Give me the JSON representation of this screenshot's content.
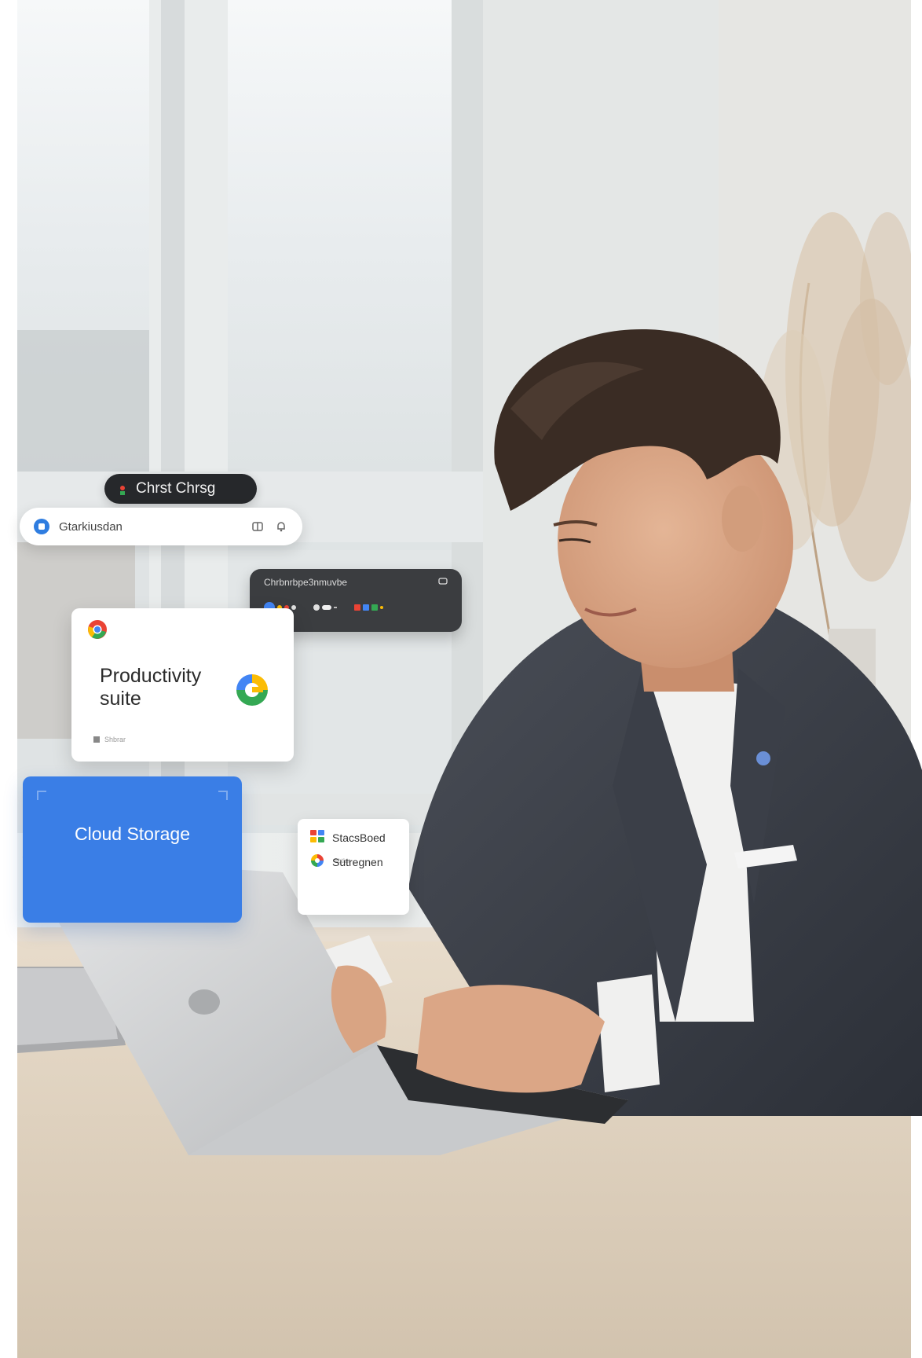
{
  "scene": {
    "description_icons": [
      "laptop",
      "window",
      "pampas-grass"
    ]
  },
  "dark_pill": {
    "label": "Chrst Chrsg",
    "icon": "google-dot-icon"
  },
  "search_bar": {
    "placeholder_text": "Gtarkiusdan",
    "left_icon": "app-badge-icon",
    "right_icons": [
      "grid-icon",
      "bell-icon"
    ]
  },
  "dark_panel": {
    "title": "Chrbnrbpe3nmuvbe",
    "corner_icon": "chat-icon"
  },
  "productivity_card": {
    "title": "Productivity suite",
    "footer": "Shbrar",
    "top_icon": "chrome-icon",
    "brand_icon": "google-g-icon"
  },
  "cloud_card": {
    "label": "Cloud Storage",
    "color": "#3a7ee6"
  },
  "mini_card": {
    "items": [
      {
        "label": "StacsBoed",
        "icon": "colorful-grid-icon"
      },
      {
        "label": "Sutregnen",
        "icon": "pinwheel-icon"
      }
    ],
    "sub_label": "Sbtlar"
  },
  "colors": {
    "google_blue": "#4285f4",
    "google_red": "#ea4335",
    "google_yellow": "#fbbc05",
    "google_green": "#34a853",
    "accent_blue": "#3a7ee6"
  }
}
